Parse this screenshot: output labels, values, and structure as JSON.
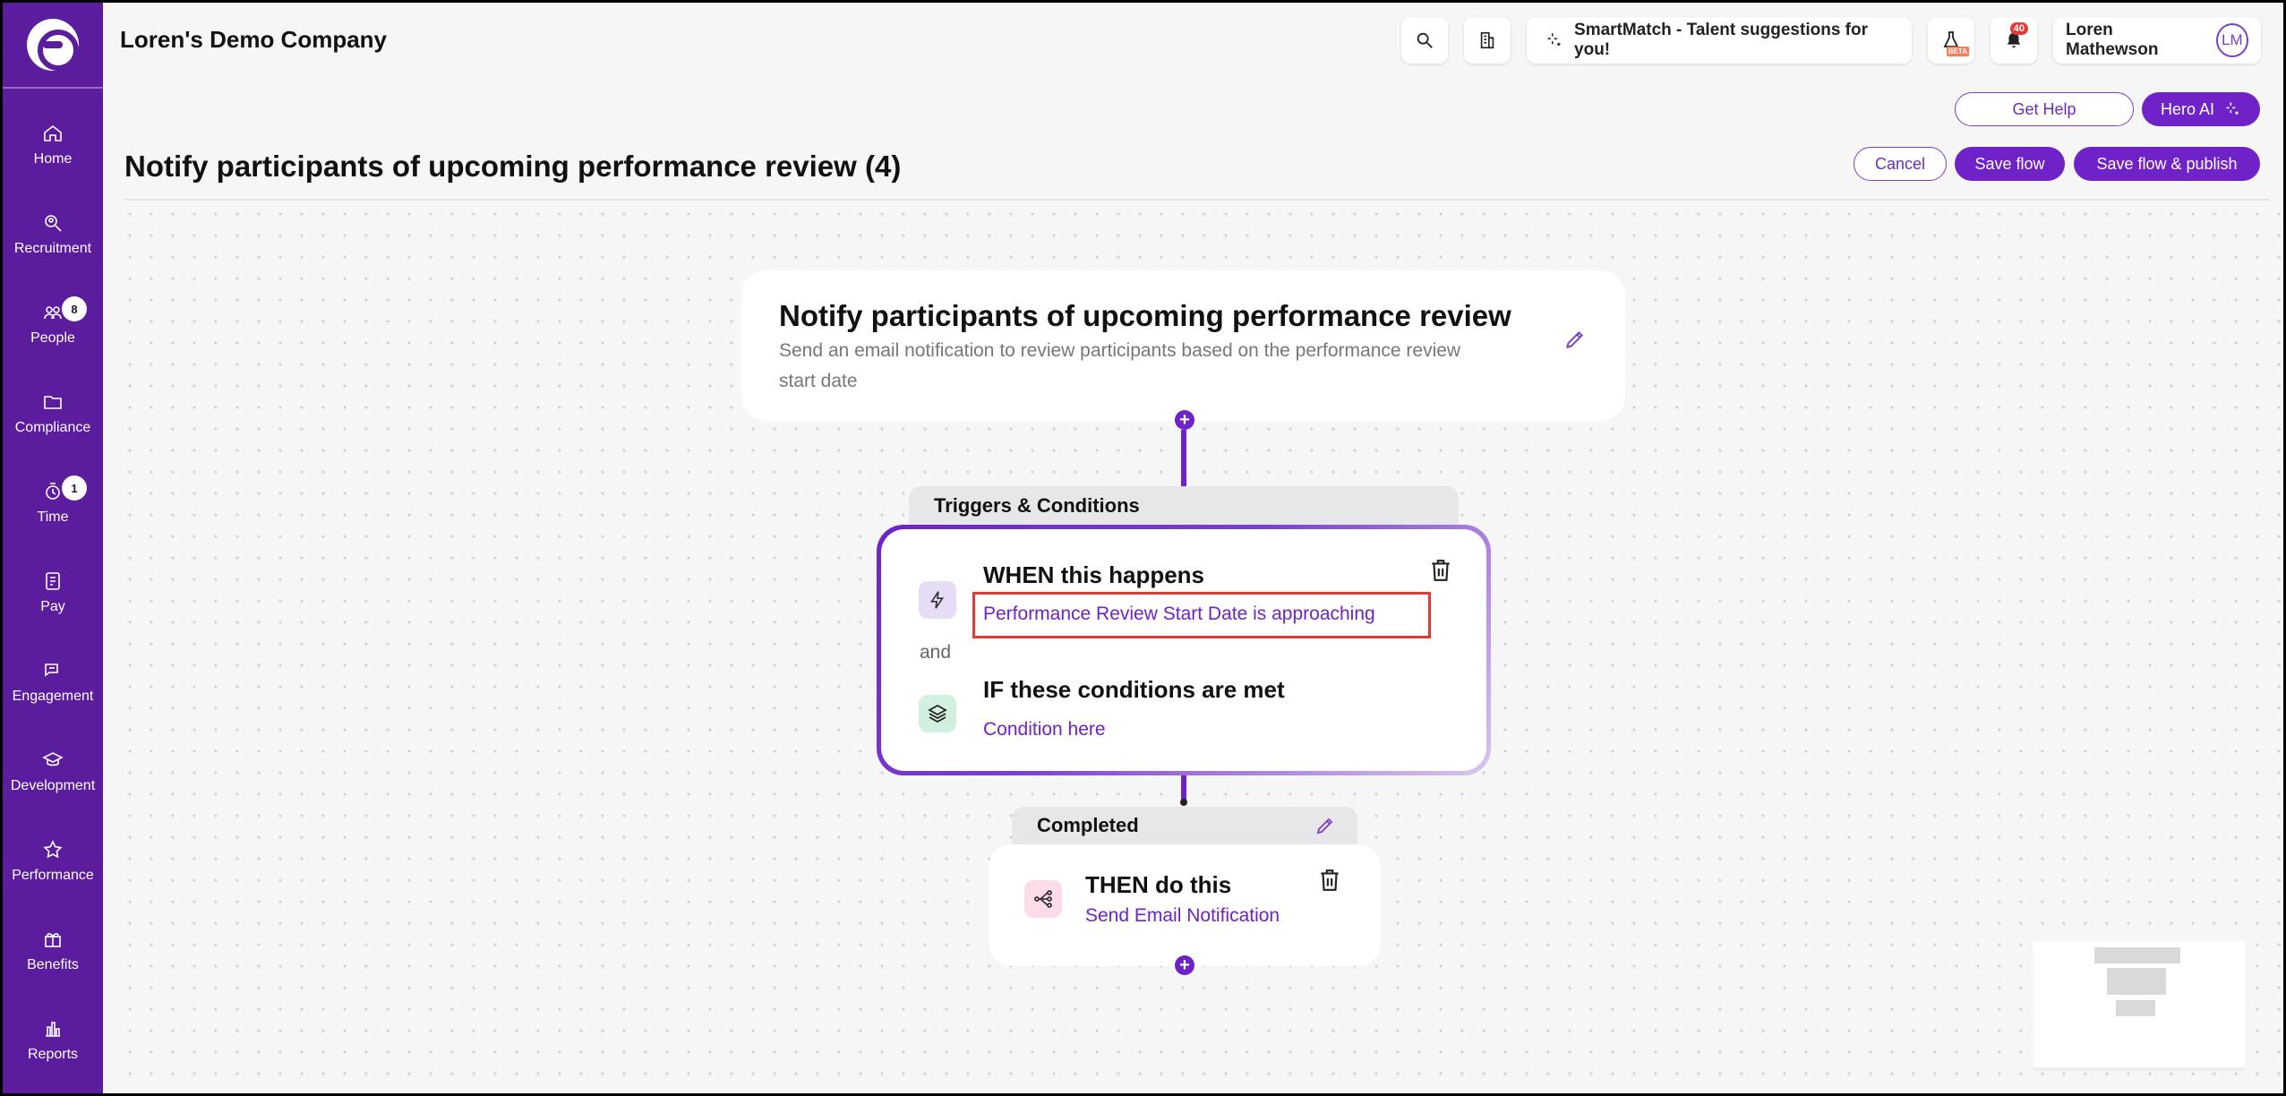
{
  "sidebar": {
    "items": [
      {
        "label": "Home",
        "icon": "home-icon"
      },
      {
        "label": "Recruitment",
        "icon": "search-person-icon"
      },
      {
        "label": "People",
        "icon": "people-icon",
        "badge": "8"
      },
      {
        "label": "Compliance",
        "icon": "folder-icon"
      },
      {
        "label": "Time",
        "icon": "clock-icon",
        "badge": "1"
      },
      {
        "label": "Pay",
        "icon": "pay-icon"
      },
      {
        "label": "Engagement",
        "icon": "chat-icon"
      },
      {
        "label": "Development",
        "icon": "graduation-icon"
      },
      {
        "label": "Performance",
        "icon": "star-icon"
      },
      {
        "label": "Benefits",
        "icon": "gift-icon"
      },
      {
        "label": "Reports",
        "icon": "bar-chart-icon"
      }
    ]
  },
  "header": {
    "company": "Loren's Demo Company",
    "smartmatch": "SmartMatch - Talent suggestions for you!",
    "beta": "BETA",
    "notifications_count": "40",
    "user_name": "Loren Mathewson",
    "user_initials": "LM"
  },
  "actions": {
    "get_help": "Get Help",
    "hero_ai": "Hero AI",
    "cancel": "Cancel",
    "save_flow": "Save flow",
    "save_publish": "Save flow & publish"
  },
  "page": {
    "title": "Notify participants of upcoming performance review (4)"
  },
  "flow": {
    "title": "Notify participants of upcoming performance review",
    "description_line1": "Send an email notification to review participants based on the performance review",
    "description_line2": "start date",
    "triggers_label": "Triggers & Conditions",
    "when_title": "WHEN this happens",
    "when_value": "Performance Review Start Date is approaching",
    "and_label": "and",
    "if_title": "IF these conditions are met",
    "if_value": "Condition here",
    "completed_label": "Completed",
    "then_title": "THEN do this",
    "then_value": "Send Email Notification"
  },
  "colors": {
    "brand": "#5b1c9e",
    "accent": "#6e22c7",
    "highlight": "#e53935"
  }
}
